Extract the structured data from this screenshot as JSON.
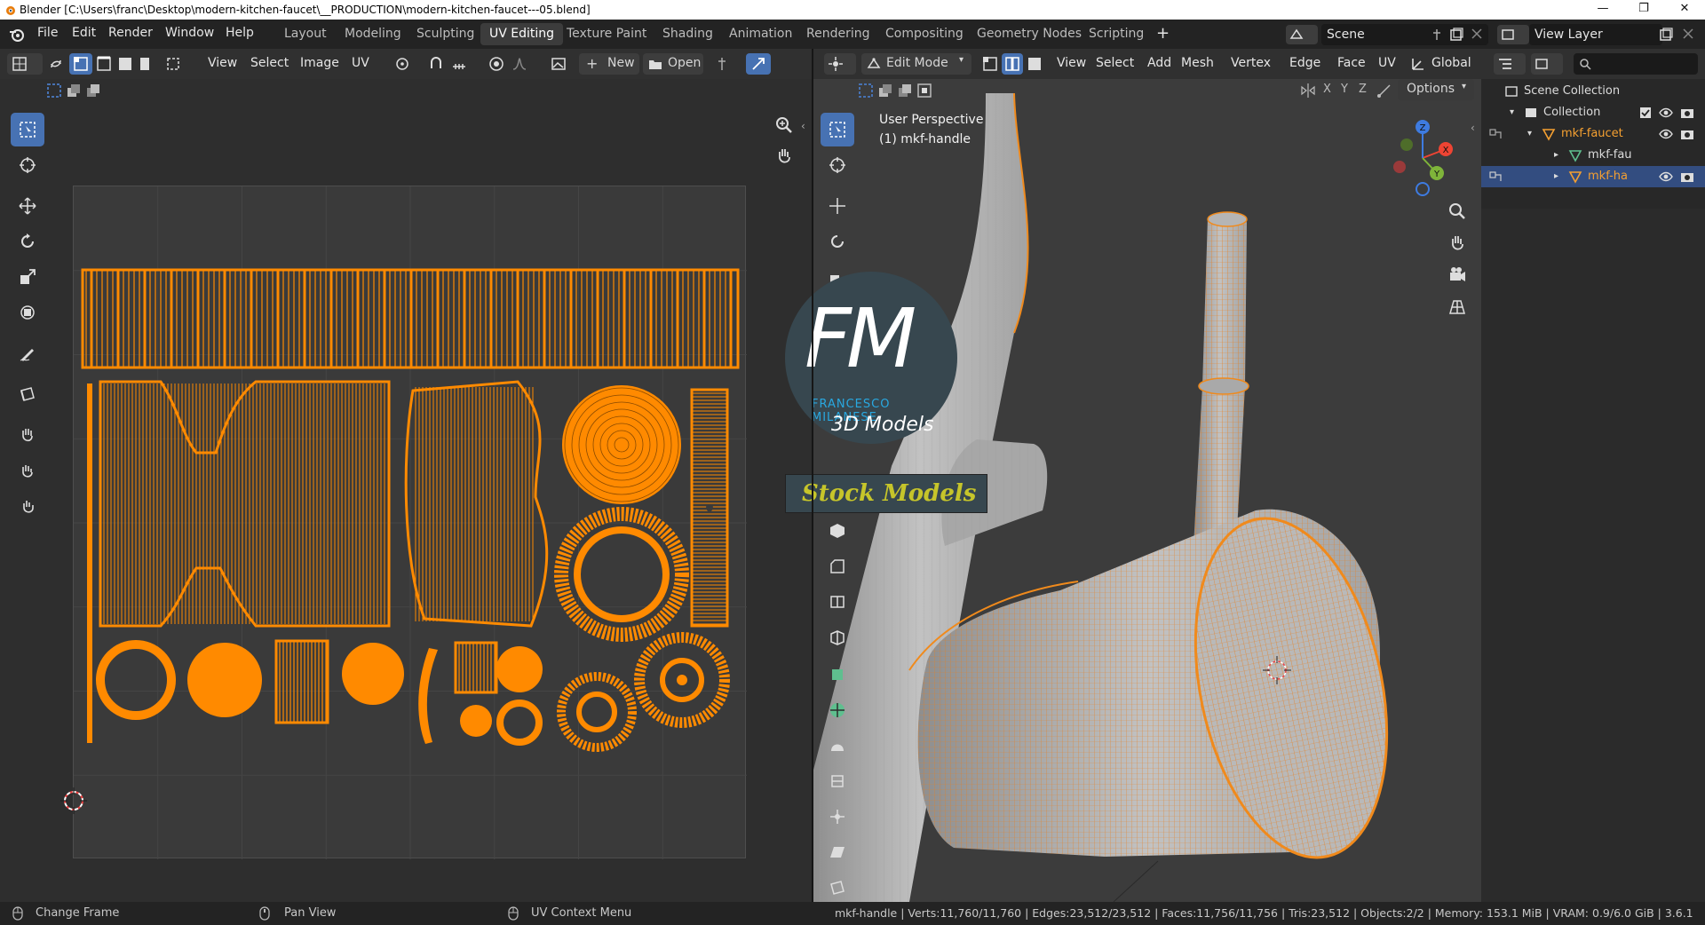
{
  "window": {
    "title": "Blender [C:\\Users\\franc\\Desktop\\modern-kitchen-faucet\\__PRODUCTION\\modern-kitchen-faucet---05.blend]",
    "controls": [
      "minimize-icon",
      "restore-icon",
      "close-icon"
    ]
  },
  "topbar": {
    "menus": [
      "File",
      "Edit",
      "Render",
      "Window",
      "Help"
    ],
    "workspaces": [
      "Layout",
      "Modeling",
      "Sculpting",
      "UV Editing",
      "Texture Paint",
      "Shading",
      "Animation",
      "Rendering",
      "Compositing",
      "Geometry Nodes",
      "Scripting"
    ],
    "active_workspace": "UV Editing",
    "add_workspace": "+",
    "scene": "Scene",
    "view_layer": "View Layer"
  },
  "uv_editor": {
    "menus": [
      "View",
      "Select",
      "Image",
      "UV"
    ],
    "new_label": "New",
    "open_label": "Open"
  },
  "viewport": {
    "mode": "Edit Mode",
    "menus": [
      "View",
      "Select",
      "Add",
      "Mesh",
      "Vertex",
      "Edge",
      "Face",
      "UV"
    ],
    "orientation": "Global",
    "options_label": "Options",
    "axes_xyz": [
      "X",
      "Y",
      "Z"
    ],
    "overlay_line1": "User Perspective",
    "overlay_line2": "(1) mkf-handle",
    "gizmo": {
      "x": "X",
      "y": "Y",
      "z": "Z"
    }
  },
  "watermark": {
    "logo": "FM",
    "name": "FRANCESCO MILANESE",
    "sub": "3D Models",
    "banner": "Stock Models"
  },
  "outliner": {
    "root": "Scene Collection",
    "items": [
      {
        "label": "Collection",
        "kind": "collection"
      },
      {
        "label": "mkf-faucet",
        "kind": "object",
        "color": "#f5a031"
      },
      {
        "label": "mkf-fau",
        "kind": "mesh"
      },
      {
        "label": "mkf-ha",
        "kind": "mesh",
        "selected": true
      }
    ]
  },
  "statusbar": {
    "left1": "Change Frame",
    "left2": "Pan View",
    "left3": "UV Context Menu",
    "stats": "mkf-handle | Verts:11,760/11,760 | Edges:23,512/23,512 | Faces:11,756/11,756 | Tris:23,512 | Objects:2/2 | Memory: 153.1 MiB | VRAM: 0.9/6.0 GiB | 3.6.1"
  },
  "colors": {
    "accent": "#4772b3",
    "selection": "#ff8a00",
    "mesh": "#c4c4c4",
    "panel": "#303030",
    "bg": "#232323"
  }
}
